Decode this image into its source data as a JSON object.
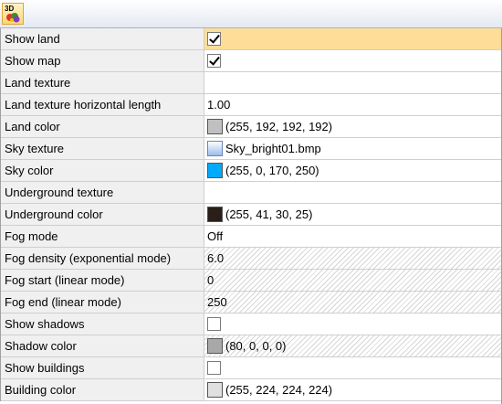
{
  "toolbar": {
    "icon": "3d-view-icon",
    "icon_label": "3D"
  },
  "properties": [
    {
      "name": "Show land",
      "type": "checkbox",
      "checked": true,
      "selected": true
    },
    {
      "name": "Show map",
      "type": "checkbox",
      "checked": true
    },
    {
      "name": "Land texture",
      "type": "text",
      "value": ""
    },
    {
      "name": "Land texture horizontal length",
      "type": "text",
      "value": "1.00"
    },
    {
      "name": "Land color",
      "type": "color",
      "color": "#c0c0c0",
      "value": "(255, 192, 192, 192)"
    },
    {
      "name": "Sky texture",
      "type": "texture",
      "value": "Sky_bright01.bmp"
    },
    {
      "name": "Sky color",
      "type": "color",
      "color": "#00aafa",
      "value": "(255, 0, 170, 250)"
    },
    {
      "name": "Underground texture",
      "type": "text",
      "value": ""
    },
    {
      "name": "Underground color",
      "type": "color",
      "color": "#291e19",
      "value": "(255, 41, 30, 25)"
    },
    {
      "name": "Fog mode",
      "type": "text",
      "value": "Off"
    },
    {
      "name": "Fog density (exponential mode)",
      "type": "text",
      "value": "6.0",
      "disabled": true
    },
    {
      "name": "Fog start (linear mode)",
      "type": "text",
      "value": "0",
      "disabled": true
    },
    {
      "name": "Fog end (linear mode)",
      "type": "text",
      "value": "250",
      "disabled": true
    },
    {
      "name": "Show shadows",
      "type": "checkbox",
      "checked": false
    },
    {
      "name": "Shadow color",
      "type": "color",
      "color": "#a8a8a8",
      "value": "(80, 0, 0, 0)",
      "disabled": true
    },
    {
      "name": "Show buildings",
      "type": "checkbox",
      "checked": false
    },
    {
      "name": "Building color",
      "type": "color",
      "color": "#e0e0e0",
      "value": "(255, 224, 224, 224)"
    }
  ]
}
